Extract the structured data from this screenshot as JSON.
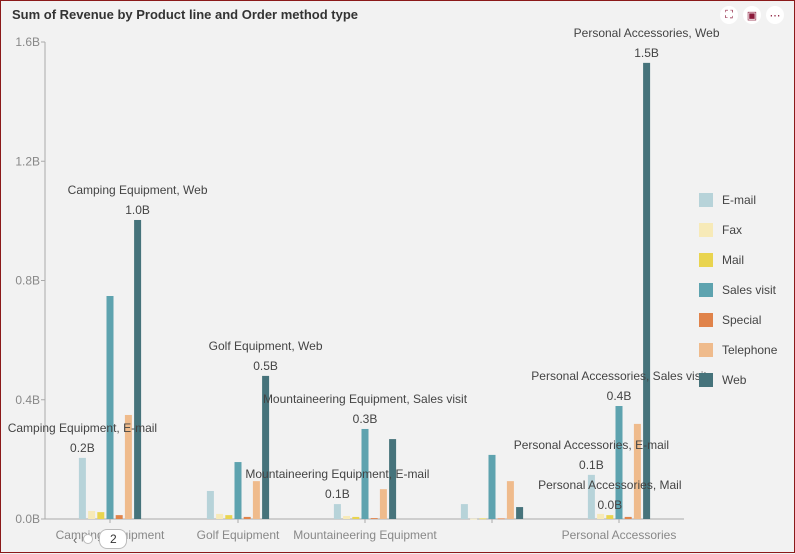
{
  "header": {
    "title": "Sum of Revenue by Product line and Order method type",
    "tools": [
      {
        "name": "expand-icon",
        "glyph": "⛶"
      },
      {
        "name": "export-icon",
        "glyph": "▣"
      },
      {
        "name": "more-icon",
        "glyph": "⋯"
      }
    ]
  },
  "pager": {
    "prev_glyph": "‹",
    "page": "2"
  },
  "colors": {
    "E-mail": "#b7d3d9",
    "Fax": "#f7eab8",
    "Mail": "#e9d44f",
    "Sales visit": "#5ea3af",
    "Special": "#e0834a",
    "Telephone": "#efbb8c",
    "Web": "#46737b"
  },
  "chart_data": {
    "type": "bar",
    "title": "Sum of Revenue by Product line and Order method type",
    "xlabel": "",
    "ylabel": "",
    "ylim": [
      0,
      1.6
    ],
    "yticks": [
      "0.0B",
      "0.4B",
      "0.8B",
      "1.2B",
      "1.6B"
    ],
    "ytick_values": [
      0,
      0.4,
      0.8,
      1.2,
      1.6
    ],
    "grid": false,
    "legend_position": "right",
    "categories": [
      "Camping Equipment",
      "Golf Equipment",
      "Mountaineering Equipment",
      "",
      "Personal Accessories"
    ],
    "series": [
      {
        "name": "E-mail",
        "values": [
          0.205,
          0.094,
          0.05,
          0.05,
          0.148
        ]
      },
      {
        "name": "Fax",
        "values": [
          0.027,
          0.017,
          0.01,
          0.001,
          0.017
        ]
      },
      {
        "name": "Mail",
        "values": [
          0.023,
          0.013,
          0.007,
          0.002,
          0.013
        ]
      },
      {
        "name": "Sales visit",
        "values": [
          0.748,
          0.191,
          0.302,
          0.215,
          0.379
        ]
      },
      {
        "name": "Special",
        "values": [
          0.013,
          0.007,
          0.003,
          0.002,
          0.007
        ]
      },
      {
        "name": "Telephone",
        "values": [
          0.349,
          0.127,
          0.1,
          0.127,
          0.319
        ]
      },
      {
        "name": "Web",
        "values": [
          1.003,
          0.48,
          0.268,
          0.04,
          1.53
        ]
      }
    ],
    "annotations": [
      {
        "category": 0,
        "series": "E-mail",
        "title": "Camping Equipment, E-mail",
        "value": "0.2B"
      },
      {
        "category": 0,
        "series": "Web",
        "title": "Camping Equipment, Web",
        "value": "1.0B"
      },
      {
        "category": 1,
        "series": "Web",
        "title": "Golf Equipment, Web",
        "value": "0.5B"
      },
      {
        "category": 2,
        "series": "E-mail",
        "title": "Mountaineering Equipment, E-mail",
        "value": "0.1B"
      },
      {
        "category": 2,
        "series": "Sales visit",
        "title": "Mountaineering Equipment, Sales visit",
        "value": "0.3B"
      },
      {
        "category": 4,
        "series": "E-mail",
        "title": "Personal Accessories, E-mail",
        "value": "0.1B"
      },
      {
        "category": 4,
        "series": "Mail",
        "title": "Personal Accessories, Mail",
        "value": "0.0B"
      },
      {
        "category": 4,
        "series": "Sales visit",
        "title": "Personal Accessories, Sales visit",
        "value": "0.4B"
      },
      {
        "category": 4,
        "series": "Web",
        "title": "Personal Accessories, Web",
        "value": "1.5B"
      }
    ]
  }
}
